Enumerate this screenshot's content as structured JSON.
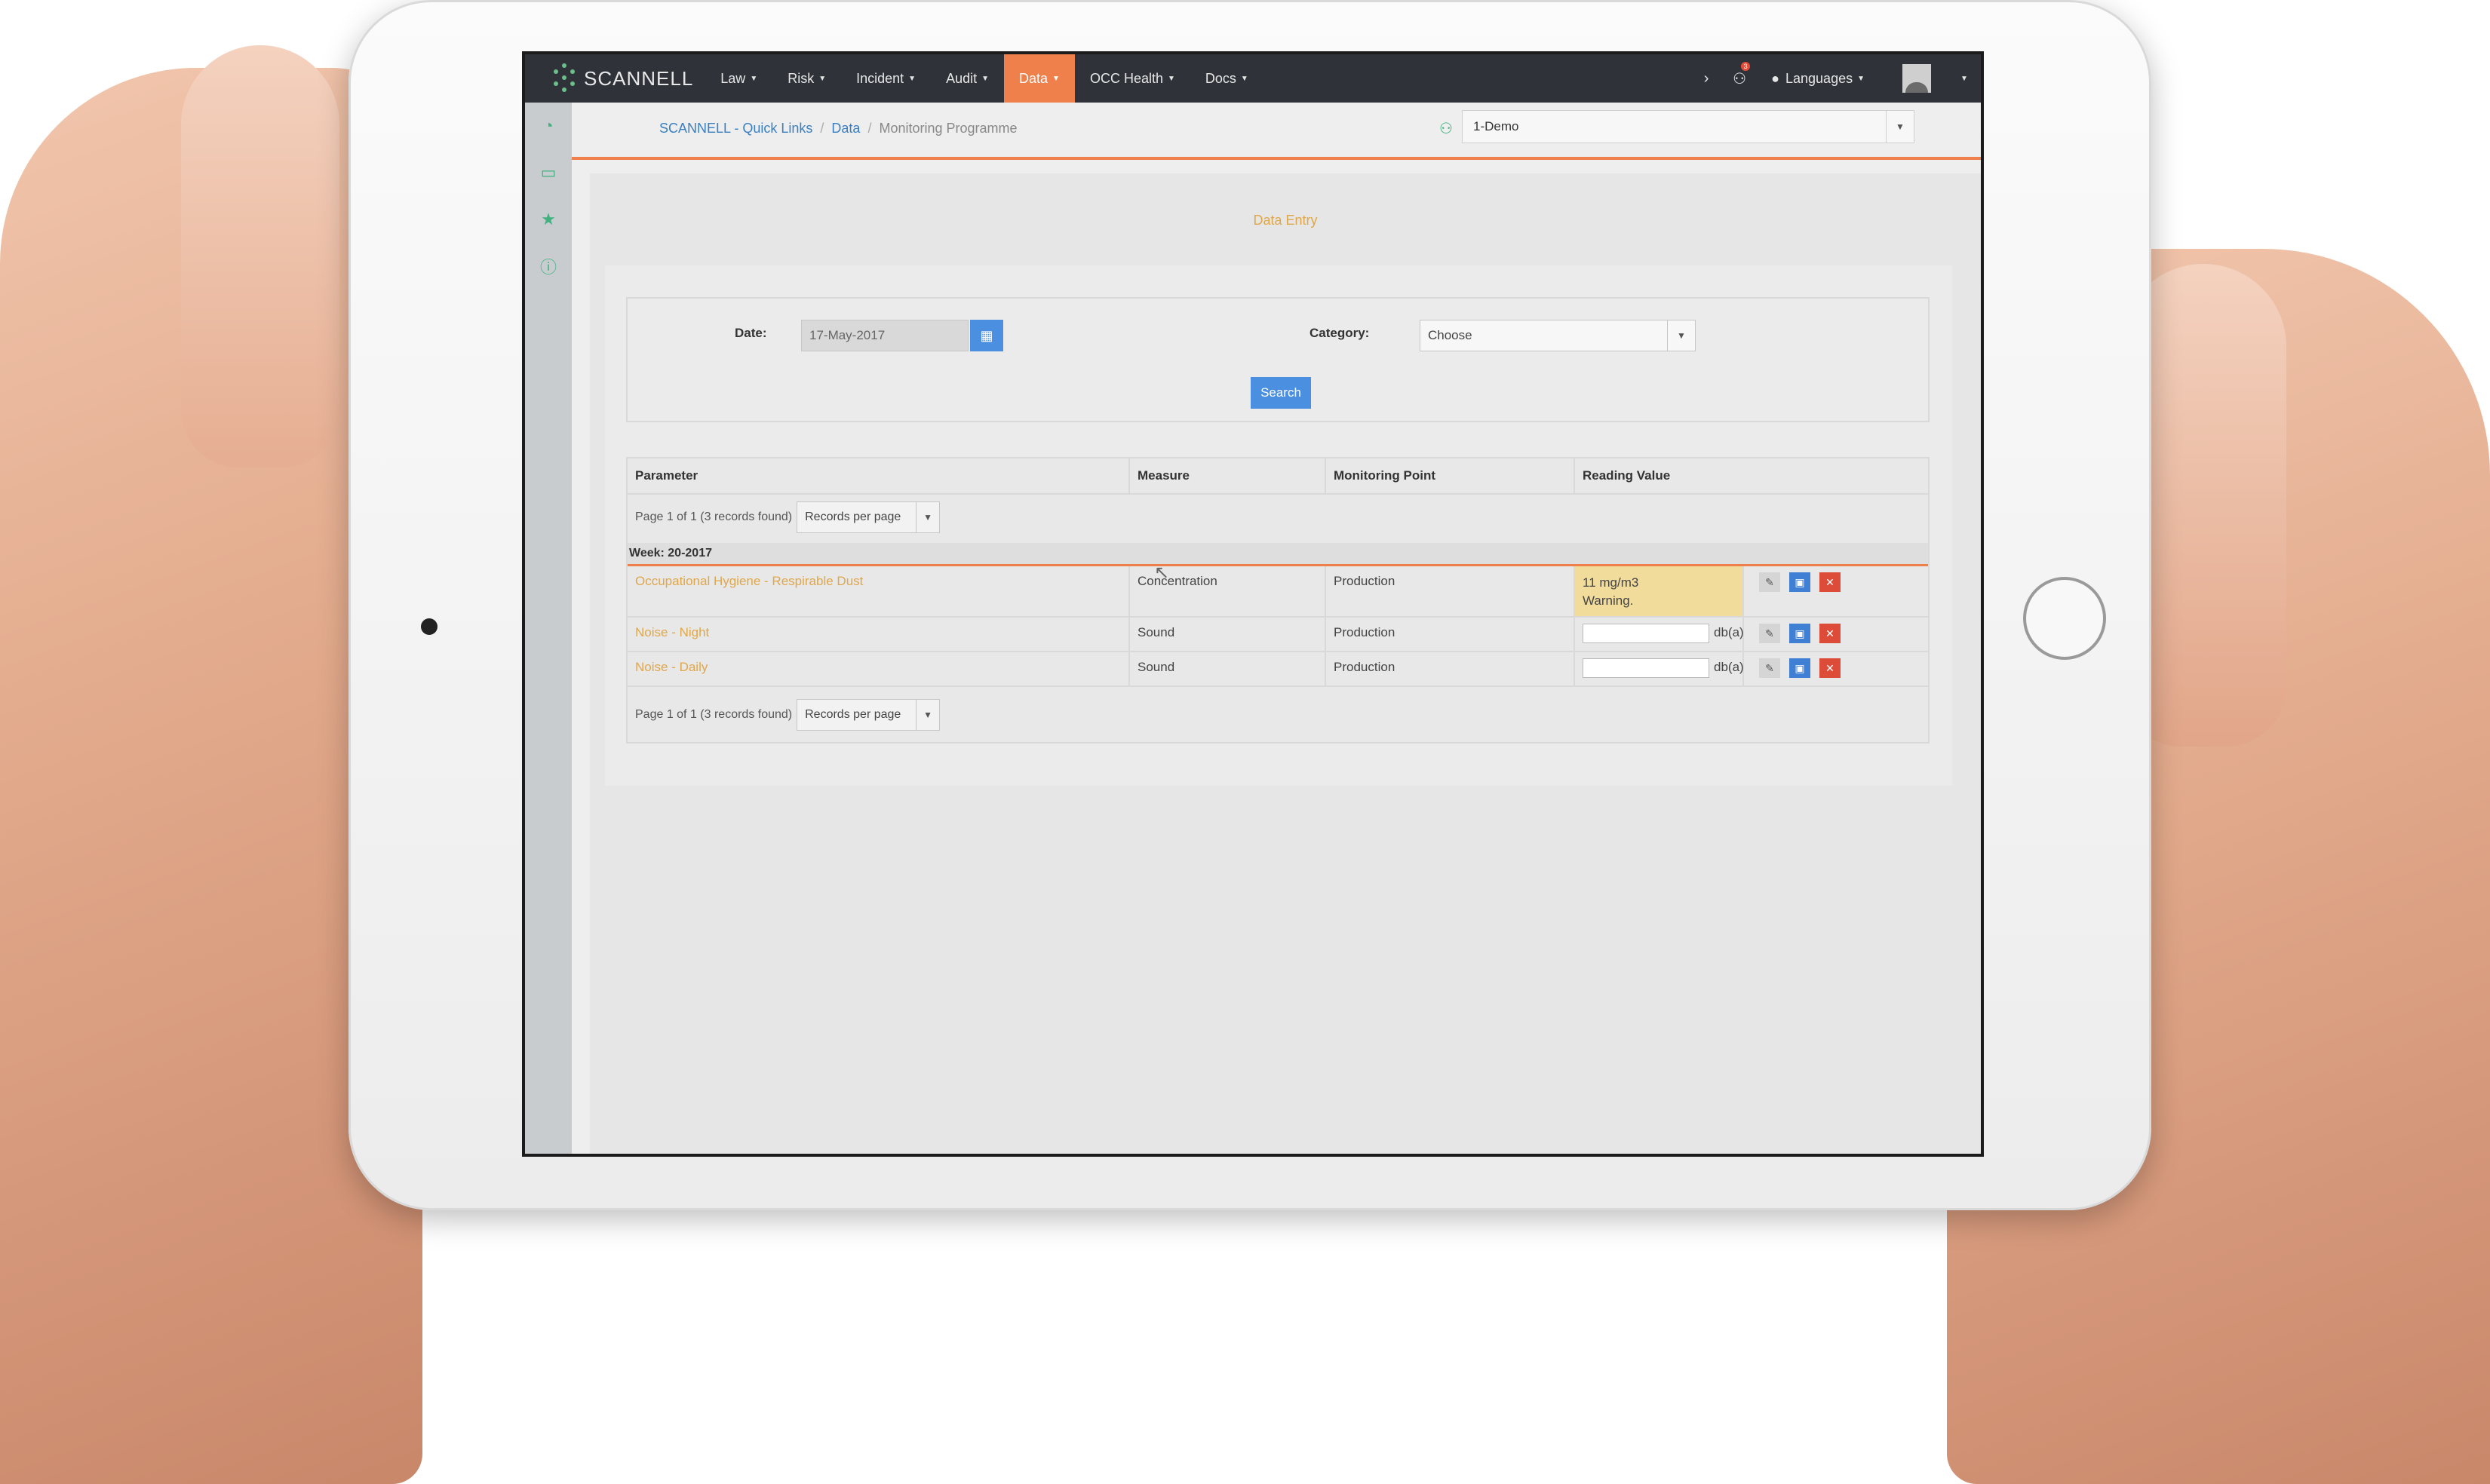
{
  "navbar": {
    "brand": "SCANNELL",
    "items": [
      {
        "label": "Law",
        "active": false
      },
      {
        "label": "Risk",
        "active": false
      },
      {
        "label": "Incident",
        "active": false
      },
      {
        "label": "Audit",
        "active": false
      },
      {
        "label": "Data",
        "active": true
      },
      {
        "label": "OCC Health",
        "active": false
      },
      {
        "label": "Docs",
        "active": false
      }
    ],
    "notification_count": "3",
    "languages_label": "Languages",
    "accent_color": "#ef7f4b"
  },
  "sidebar": {
    "icons": [
      "dashboard-icon",
      "monitor-icon",
      "star-icon",
      "info-icon"
    ]
  },
  "breadcrumb": {
    "home": "SCANNELL - Quick Links",
    "section": "Data",
    "current": "Monitoring Programme",
    "separator": "/"
  },
  "org_select": {
    "value": "1-Demo"
  },
  "page": {
    "heading": "Data Entry"
  },
  "filters": {
    "date_label": "Date:",
    "date_value": "17-May-2017",
    "category_label": "Category:",
    "category_value": "Choose",
    "search_label": "Search"
  },
  "grid": {
    "columns": [
      "Parameter",
      "Measure",
      "Monitoring Point",
      "Reading Value"
    ],
    "pager_text": "Page 1 of 1 (3 records found)",
    "records_per_page": "Records per page",
    "week_label": "Week: 20-2017",
    "rows": [
      {
        "parameter": "Occupational Hygiene - Respirable Dust",
        "measure": "Concentration",
        "point": "Production",
        "reading": "11 mg/m3",
        "warning": "Warning."
      },
      {
        "parameter": "Noise - Night",
        "measure": "Sound",
        "point": "Production",
        "unit": "db(a)"
      },
      {
        "parameter": "Noise - Daily",
        "measure": "Sound",
        "point": "Production",
        "unit": "db(a)"
      }
    ]
  }
}
